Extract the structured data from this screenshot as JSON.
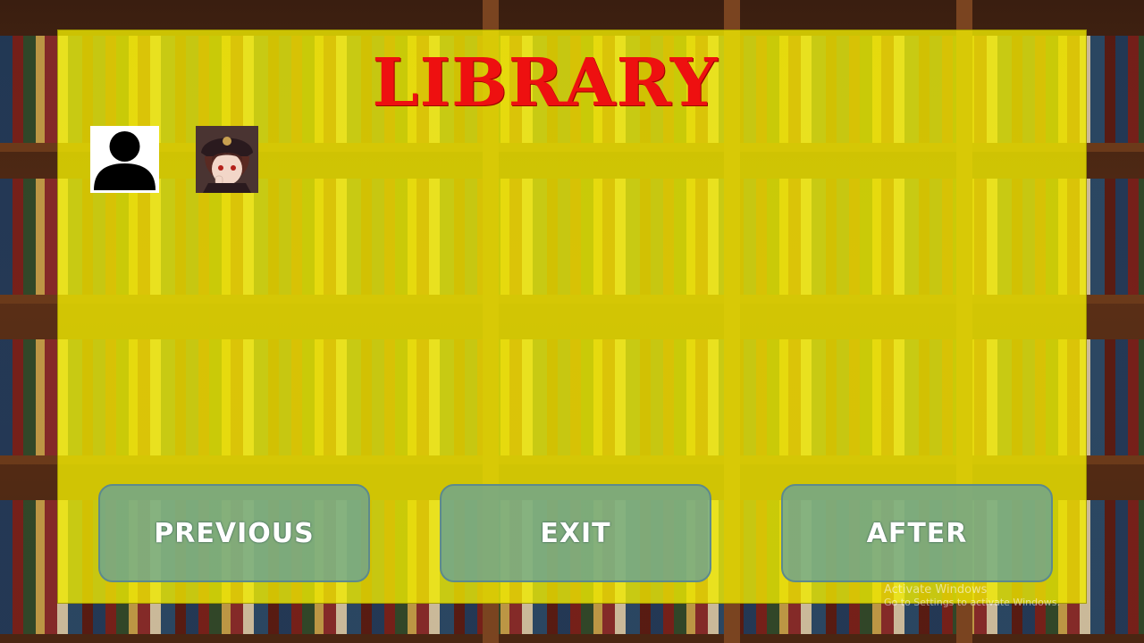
{
  "title": "LIBRARY",
  "profile_icon": "user-silhouette-icon",
  "avatar_icon": "character-avatar",
  "buttons": {
    "previous": "PREVIOUS",
    "exit": "EXIT",
    "after": "AFTER"
  },
  "watermark": {
    "title": "Activate Windows",
    "subtitle": "Go to Settings to activate Windows."
  },
  "colors": {
    "panel": "#f0eb00",
    "title": "#ee1010",
    "button": "#5fa0a5"
  }
}
